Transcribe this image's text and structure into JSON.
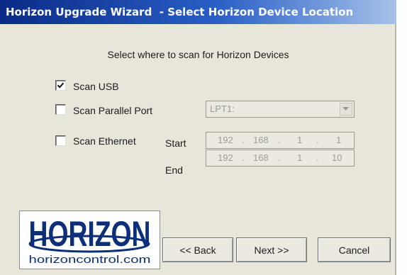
{
  "window": {
    "title": "Horizon Upgrade Wizard  - Select Horizon Device Location"
  },
  "prompt": "Select where to scan for Horizon Devices",
  "options": {
    "scan_usb": {
      "label": "Scan USB",
      "checked": true
    },
    "scan_parallel": {
      "label": "Scan Parallel Port",
      "checked": false,
      "port_value": "LPT1:"
    },
    "scan_ethernet": {
      "label": "Scan Ethernet",
      "checked": false
    }
  },
  "ethernet": {
    "start_label": "Start",
    "end_label": "End",
    "start_ip": [
      "192",
      "168",
      "1",
      "1"
    ],
    "end_ip": [
      "192",
      "168",
      "1",
      "10"
    ]
  },
  "logo": {
    "wordmark": "HORIZON",
    "url_text": "horizoncontrol.com"
  },
  "buttons": {
    "back": "<< Back",
    "next": "Next >>",
    "cancel": "Cancel"
  },
  "colors": {
    "titlebar_start": "#0a2a86",
    "titlebar_end": "#a6c2ea",
    "dialog_bg": "#e8e5da",
    "logo_text": "#0d2f7a"
  }
}
